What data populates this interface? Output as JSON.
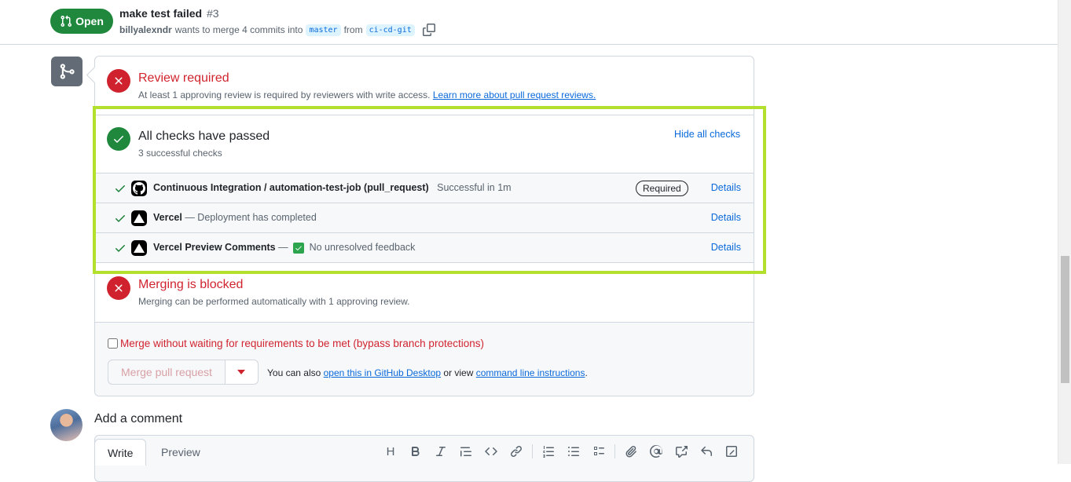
{
  "header": {
    "state": "Open",
    "title": "make test failed",
    "number": "#3",
    "author": "billyalexndr",
    "meta_text": "wants to merge 4 commits into",
    "base_branch": "master",
    "from_text": "from",
    "head_branch": "ci-cd-git"
  },
  "review": {
    "title": "Review required",
    "subtitle": "At least 1 approving review is required by reviewers with write access.",
    "link": "Learn more about pull request reviews."
  },
  "checks": {
    "title": "All checks have passed",
    "subtitle": "3 successful checks",
    "toggle_label": "Hide all checks",
    "items": [
      {
        "name": "Continuous Integration / automation-test-job (pull_request)",
        "status": "Successful in 1m",
        "badge": "Required",
        "details": "Details",
        "app_icon": "github-icon"
      },
      {
        "name": "Vercel",
        "status": "— Deployment has completed",
        "details": "Details",
        "app_icon": "vercel-icon"
      },
      {
        "name": "Vercel Preview Comments",
        "status_prefix": "—",
        "status": "No unresolved feedback",
        "details": "Details",
        "app_icon": "vercel-icon"
      }
    ]
  },
  "blocked": {
    "title": "Merging is blocked",
    "subtitle": "Merging can be performed automatically with 1 approving review."
  },
  "merge": {
    "bypass_label": "Merge without waiting for requirements to be met (bypass branch protections)",
    "button_label": "Merge pull request",
    "also_prefix": "You can also",
    "desktop_link": "open this in GitHub Desktop",
    "or_view": "or view",
    "cli_link": "command line instructions",
    "period": "."
  },
  "comment": {
    "title": "Add a comment",
    "tab_write": "Write",
    "tab_preview": "Preview",
    "toolbar_label_heading": "H"
  },
  "colors": {
    "open_green": "#1f883d",
    "danger_red": "#cf222e",
    "link_blue": "#0969da",
    "highlight": "#b3e02d"
  }
}
